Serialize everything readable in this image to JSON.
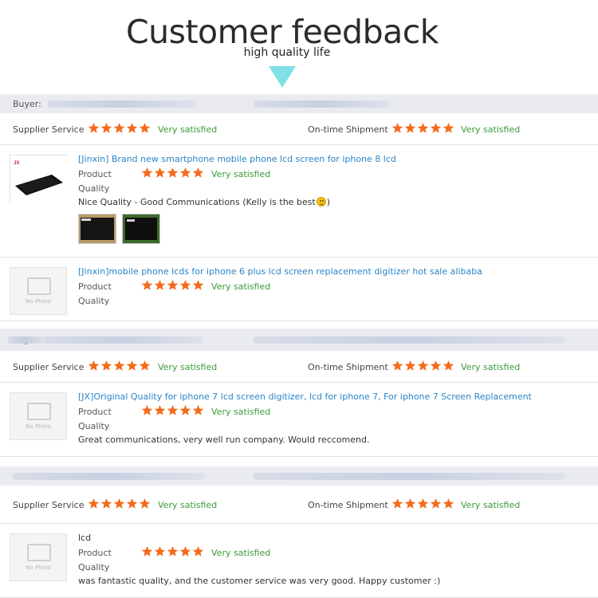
{
  "header": {
    "title": "Customer feedback",
    "subtitle": "high quality life"
  },
  "colors": {
    "star": "#f36b1c",
    "satisfied": "#3a9a3a",
    "link": "#2a84c8",
    "bar": "#e9ebf0",
    "arrow": "#7fe0e6"
  },
  "labels": {
    "buyer": "Buyer:",
    "supplier_service": "Supplier Service",
    "ontime_shipment": "On-time Shipment",
    "product": "Product",
    "quality": "Quality",
    "very_satisfied": "Very satisfied",
    "no_photo": "No Photo"
  },
  "feedbacks": [
    {
      "buyer_visible": "Buyer:",
      "supplier_rating": 5,
      "shipment_rating": 5,
      "products": [
        {
          "title": "[Jinxin] Brand new smartphone mobile phone lcd screen for iphone 8 lcd",
          "product_rating": 5,
          "comment": "Nice Quality - Good Communications (Kelly is the best",
          "comment_end": ")",
          "has_photo": true,
          "attached_photos": 2
        },
        {
          "title": "[Jinxin]mobile phone lcds for iphone 6 plus lcd screen replacement digitizer hot sale alibaba",
          "product_rating": 5,
          "comment": "",
          "has_photo": false
        }
      ]
    },
    {
      "buyer_visible": "Buyer:",
      "supplier_rating": 5,
      "shipment_rating": 5,
      "products": [
        {
          "title": "[JX]Original Quality for iphone 7 lcd screen digitizer, lcd for iphone 7, For iphone 7 Screen Replacement",
          "product_rating": 5,
          "comment": "Great communications, very well run company. Would reccomend.",
          "has_photo": false
        }
      ]
    },
    {
      "buyer_visible": "",
      "supplier_rating": 5,
      "shipment_rating": 5,
      "products": [
        {
          "title": "lcd",
          "product_rating": 5,
          "comment": "was fantastic quality, and the customer service was very good. Happy customer :)",
          "has_photo": false
        }
      ]
    }
  ]
}
